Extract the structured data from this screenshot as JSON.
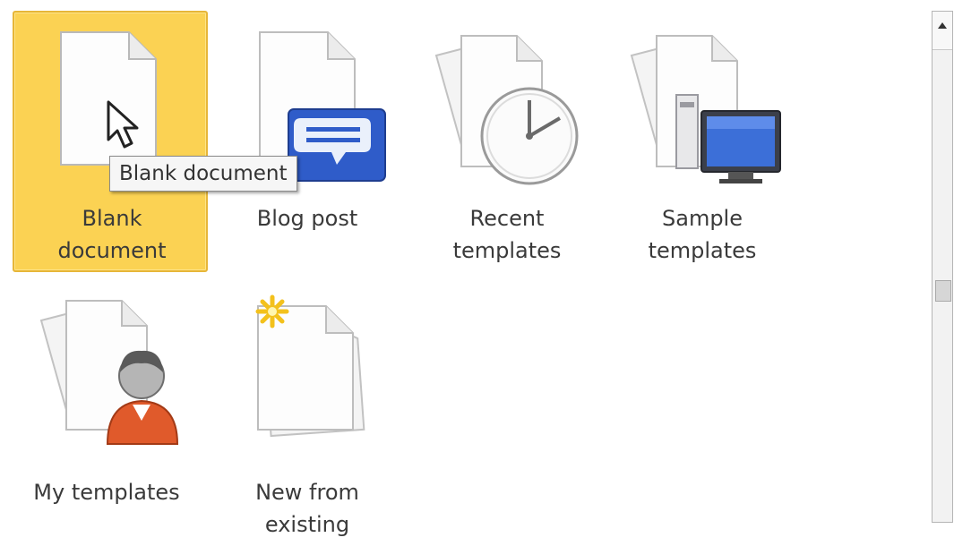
{
  "templates": [
    {
      "label": "Blank document",
      "icon": "blank-document-icon",
      "selected": true
    },
    {
      "label": "Blog post",
      "icon": "blog-post-icon",
      "selected": false
    },
    {
      "label": "Recent\ntemplates",
      "icon": "recent-templates-icon",
      "selected": false
    },
    {
      "label": "Sample\ntemplates",
      "icon": "sample-templates-icon",
      "selected": false
    },
    {
      "label": "My templates",
      "icon": "my-templates-icon",
      "selected": false
    },
    {
      "label": "New from\nexisting",
      "icon": "new-from-existing-icon",
      "selected": false
    }
  ],
  "blank_label": "Blank\ndocument",
  "tooltip": "Blank document",
  "colors": {
    "selection": "#fbd253",
    "selection_border": "#e7b638"
  }
}
